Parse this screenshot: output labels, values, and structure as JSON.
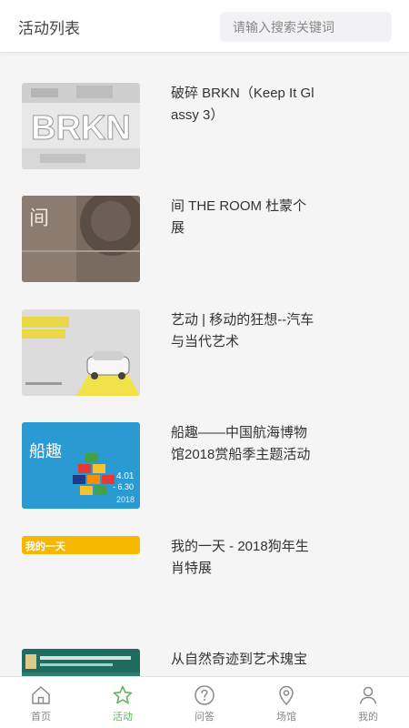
{
  "header": {
    "title": "活动列表",
    "search_placeholder": "请输入搜索关键词"
  },
  "activities": [
    {
      "title": "破碎 BRKN（Keep It Glassy 3）",
      "thumb_text": "BRKN",
      "thumb_icon": "brkn-poster"
    },
    {
      "title": "间 THE ROOM 杜蒙个展",
      "thumb_text": "间",
      "thumb_icon": "the-room-poster"
    },
    {
      "title": "艺动 | 移动的狂想--汽车与当代艺术",
      "thumb_text": "",
      "thumb_icon": "car-art-poster"
    },
    {
      "title": "船趣——中国航海博物馆2018赏船季主题活动",
      "thumb_text": "船趣",
      "thumb_sub1": "4.01",
      "thumb_sub2": "- 6.30",
      "thumb_sub3": "2018",
      "thumb_icon": "boat-poster"
    },
    {
      "title": "我的一天 - 2018狗年生肖特展",
      "thumb_text": "我的一天",
      "thumb_icon": "dog-year-poster"
    },
    {
      "title": "从自然奇迹到艺术瑰宝",
      "thumb_text": "",
      "thumb_icon": "nature-art-poster"
    }
  ],
  "tabs": [
    {
      "label": "首页",
      "icon": "home-icon",
      "active": false
    },
    {
      "label": "活动",
      "icon": "star-icon",
      "active": true
    },
    {
      "label": "问答",
      "icon": "question-icon",
      "active": false
    },
    {
      "label": "场馆",
      "icon": "location-icon",
      "active": false
    },
    {
      "label": "我的",
      "icon": "user-icon",
      "active": false
    }
  ],
  "colors": {
    "accent": "#5cb85c",
    "inactive": "#888888",
    "background": "#f5f5f5"
  }
}
